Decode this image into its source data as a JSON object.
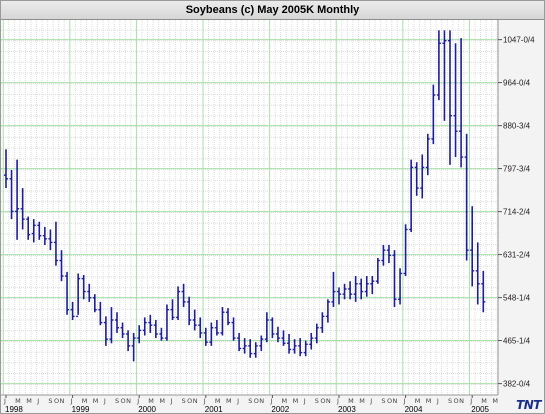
{
  "window": {
    "title": "Soybeans (c) May 2005K Monthly"
  },
  "colors": {
    "bars": "#1c1c9c",
    "grid_minor": "#dcdcdc",
    "grid_major": "#a8e0a8",
    "background": "#ffffff",
    "axis_panel": "#f3f3f3"
  },
  "logo": {
    "text": "TNT"
  },
  "chart_data": {
    "type": "ohlc",
    "title": "Soybeans (c) May 2005K Monthly",
    "grid": true,
    "ylim": [
      360,
      1085
    ],
    "y_ticks": [
      {
        "value": 382,
        "label": "382-0/4"
      },
      {
        "value": 465.25,
        "label": "465-1/4"
      },
      {
        "value": 548.25,
        "label": "548-1/4"
      },
      {
        "value": 631.5,
        "label": "631-2/4"
      },
      {
        "value": 714.5,
        "label": "714-2/4"
      },
      {
        "value": 797.75,
        "label": "797-3/4"
      },
      {
        "value": 880.75,
        "label": "880-3/4"
      },
      {
        "value": 964,
        "label": "964-0/4"
      },
      {
        "value": 1047,
        "label": "1047-0/4"
      }
    ],
    "x_labels": [
      "1998",
      "1999",
      "2000",
      "2001",
      "2002",
      "2003",
      "2004",
      "2005"
    ],
    "months": [
      "Jan 1998",
      "Feb 1998",
      "Mar 1998",
      "Apr 1998",
      "May 1998",
      "Jun 1998",
      "Jul 1998",
      "Aug 1998",
      "Sep 1998",
      "Oct 1998",
      "Nov 1998",
      "Dec 1998",
      "Jan 1999",
      "Feb 1999",
      "Mar 1999",
      "Apr 1999",
      "May 1999",
      "Jun 1999",
      "Jul 1999",
      "Aug 1999",
      "Sep 1999",
      "Oct 1999",
      "Nov 1999",
      "Dec 1999",
      "Jan 2000",
      "Feb 2000",
      "Mar 2000",
      "Apr 2000",
      "May 2000",
      "Jun 2000",
      "Jul 2000",
      "Aug 2000",
      "Sep 2000",
      "Oct 2000",
      "Nov 2000",
      "Dec 2000",
      "Jan 2001",
      "Feb 2001",
      "Mar 2001",
      "Apr 2001",
      "May 2001",
      "Jun 2001",
      "Jul 2001",
      "Aug 2001",
      "Sep 2001",
      "Oct 2001",
      "Nov 2001",
      "Dec 2001",
      "Jan 2002",
      "Feb 2002",
      "Mar 2002",
      "Apr 2002",
      "May 2002",
      "Jun 2002",
      "Jul 2002",
      "Aug 2002",
      "Sep 2002",
      "Oct 2002",
      "Nov 2002",
      "Dec 2002",
      "Jan 2003",
      "Feb 2003",
      "Mar 2003",
      "Apr 2003",
      "May 2003",
      "Jun 2003",
      "Jul 2003",
      "Aug 2003",
      "Sep 2003",
      "Oct 2003",
      "Nov 2003",
      "Dec 2003",
      "Jan 2004",
      "Feb 2004",
      "Mar 2004",
      "Apr 2004",
      "May 2004",
      "Jun 2004",
      "Jul 2004",
      "Aug 2004",
      "Sep 2004",
      "Oct 2004",
      "Nov 2004",
      "Dec 2004",
      "Jan 2005",
      "Feb 2005",
      "Mar 2005"
    ],
    "ohlc": [
      [
        785,
        835,
        760,
        778
      ],
      [
        778,
        795,
        700,
        715
      ],
      [
        715,
        815,
        660,
        720
      ],
      [
        720,
        760,
        680,
        700
      ],
      [
        700,
        705,
        660,
        670
      ],
      [
        672,
        700,
        655,
        688
      ],
      [
        688,
        695,
        660,
        668
      ],
      [
        668,
        685,
        650,
        662
      ],
      [
        662,
        680,
        640,
        655
      ],
      [
        655,
        695,
        610,
        620
      ],
      [
        620,
        640,
        580,
        590
      ],
      [
        590,
        598,
        515,
        525
      ],
      [
        525,
        540,
        505,
        512
      ],
      [
        512,
        595,
        515,
        585
      ],
      [
        585,
        592,
        545,
        560
      ],
      [
        560,
        575,
        540,
        548
      ],
      [
        548,
        555,
        520,
        525
      ],
      [
        525,
        540,
        495,
        500
      ],
      [
        500,
        512,
        455,
        468
      ],
      [
        468,
        530,
        460,
        505
      ],
      [
        505,
        520,
        480,
        490
      ],
      [
        490,
        500,
        470,
        478
      ],
      [
        478,
        485,
        445,
        455
      ],
      [
        455,
        480,
        425,
        470
      ],
      [
        470,
        495,
        460,
        485
      ],
      [
        485,
        510,
        475,
        500
      ],
      [
        500,
        515,
        480,
        495
      ],
      [
        495,
        505,
        470,
        478
      ],
      [
        478,
        490,
        465,
        470
      ],
      [
        470,
        535,
        465,
        525
      ],
      [
        525,
        545,
        505,
        510
      ],
      [
        510,
        570,
        505,
        560
      ],
      [
        560,
        575,
        530,
        540
      ],
      [
        540,
        550,
        495,
        505
      ],
      [
        505,
        525,
        485,
        495
      ],
      [
        495,
        510,
        470,
        480
      ],
      [
        480,
        490,
        455,
        462
      ],
      [
        462,
        500,
        455,
        490
      ],
      [
        490,
        505,
        475,
        480
      ],
      [
        480,
        530,
        475,
        520
      ],
      [
        520,
        528,
        495,
        500
      ],
      [
        500,
        510,
        465,
        470
      ],
      [
        470,
        480,
        445,
        450
      ],
      [
        450,
        470,
        440,
        455
      ],
      [
        455,
        468,
        432,
        440
      ],
      [
        440,
        462,
        432,
        455
      ],
      [
        455,
        475,
        445,
        468
      ],
      [
        468,
        520,
        462,
        505
      ],
      [
        505,
        510,
        470,
        478
      ],
      [
        478,
        492,
        462,
        470
      ],
      [
        470,
        485,
        455,
        460
      ],
      [
        460,
        478,
        440,
        448
      ],
      [
        448,
        468,
        440,
        455
      ],
      [
        455,
        470,
        435,
        442
      ],
      [
        442,
        465,
        435,
        458
      ],
      [
        458,
        480,
        448,
        470
      ],
      [
        470,
        498,
        460,
        490
      ],
      [
        490,
        520,
        480,
        512
      ],
      [
        512,
        545,
        500,
        540
      ],
      [
        540,
        598,
        530,
        560
      ],
      [
        560,
        568,
        535,
        555
      ],
      [
        555,
        575,
        545,
        565
      ],
      [
        565,
        580,
        545,
        555
      ],
      [
        555,
        590,
        540,
        575
      ],
      [
        575,
        585,
        545,
        560
      ],
      [
        560,
        590,
        550,
        575
      ],
      [
        575,
        590,
        555,
        580
      ],
      [
        580,
        625,
        575,
        620
      ],
      [
        620,
        650,
        610,
        640
      ],
      [
        640,
        650,
        615,
        630
      ],
      [
        630,
        640,
        530,
        545
      ],
      [
        545,
        605,
        535,
        595
      ],
      [
        595,
        690,
        590,
        680
      ],
      [
        680,
        815,
        675,
        800
      ],
      [
        800,
        810,
        745,
        760
      ],
      [
        760,
        825,
        740,
        800
      ],
      [
        800,
        865,
        785,
        855
      ],
      [
        855,
        960,
        845,
        940
      ],
      [
        940,
        1065,
        930,
        1040
      ],
      [
        1040,
        1065,
        890,
        1045
      ],
      [
        1045,
        1065,
        805,
        900
      ],
      [
        900,
        1040,
        820,
        870
      ],
      [
        870,
        1050,
        800,
        820
      ],
      [
        820,
        865,
        620,
        640
      ],
      [
        640,
        725,
        570,
        600
      ],
      [
        600,
        655,
        535,
        575
      ],
      [
        575,
        600,
        520,
        540
      ]
    ]
  }
}
